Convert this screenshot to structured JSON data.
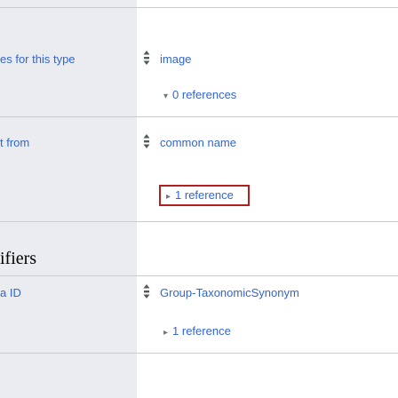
{
  "statements": [
    {
      "property": "es for this type",
      "value": "image",
      "references": "0 references",
      "caret": "▾"
    },
    {
      "property": "t from",
      "value": "common name",
      "references": "1 reference",
      "caret": "▸"
    },
    {
      "property": "a ID",
      "value": "Group-TaxonomicSynonym",
      "references": "1 reference",
      "caret": "▸"
    }
  ],
  "section": {
    "heading": "ifiers"
  },
  "colors": {
    "link": "#3366cc",
    "left_column_bg": "#eaecf0",
    "divider": "#c8ccd1",
    "highlight_box": "#b21f1f"
  },
  "icons": {
    "rank": "rank-normal-icon"
  }
}
